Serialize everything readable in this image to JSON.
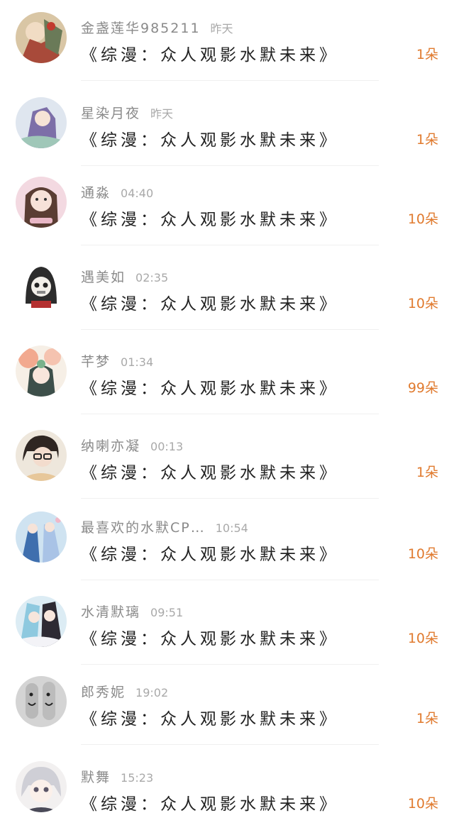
{
  "gifts": [
    {
      "name": "金盏莲华985211",
      "time": "昨天",
      "title": "《综漫：众人观影水默未来》",
      "count": "1朵"
    },
    {
      "name": "星染月夜",
      "time": "昨天",
      "title": "《综漫：众人观影水默未来》",
      "count": "1朵"
    },
    {
      "name": "通淼",
      "time": "04:40",
      "title": "《综漫：众人观影水默未来》",
      "count": "10朵"
    },
    {
      "name": "遇美如",
      "time": "02:35",
      "title": "《综漫：众人观影水默未来》",
      "count": "10朵"
    },
    {
      "name": "芊梦",
      "time": "01:34",
      "title": "《综漫：众人观影水默未来》",
      "count": "99朵"
    },
    {
      "name": "纳喇亦凝",
      "time": "00:13",
      "title": "《综漫：众人观影水默未来》",
      "count": "1朵"
    },
    {
      "name": "最喜欢的水默CP…",
      "time": "10:54",
      "title": "《综漫：众人观影水默未来》",
      "count": "10朵"
    },
    {
      "name": "水清默璃",
      "time": "09:51",
      "title": "《综漫：众人观影水默未来》",
      "count": "10朵"
    },
    {
      "name": "郎秀妮",
      "time": "19:02",
      "title": "《综漫：众人观影水默未来》",
      "count": "1朵"
    },
    {
      "name": "默舞",
      "time": "15:23",
      "title": "《综漫：众人观影水默未来》",
      "count": "10朵"
    }
  ],
  "colors": {
    "accent": "#e07a2e",
    "name": "#8a8a8a",
    "title": "#222222",
    "time": "#a9a9a9"
  }
}
